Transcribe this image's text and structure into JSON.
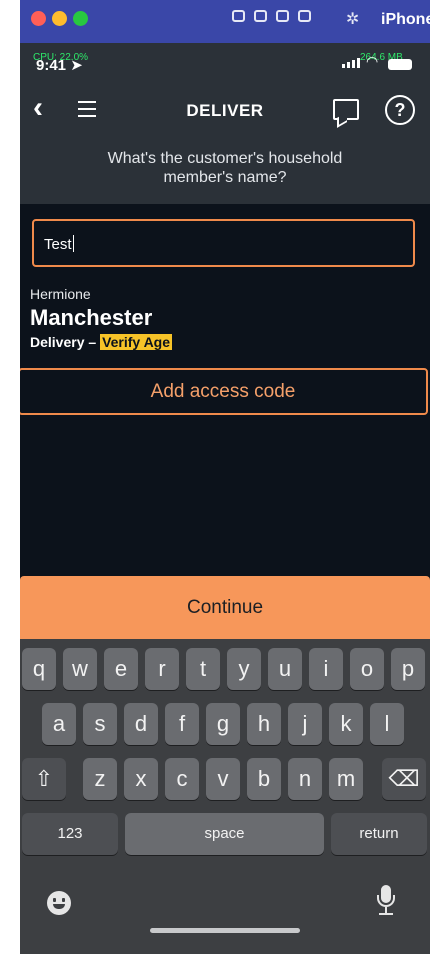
{
  "simulator": {
    "title": "iPhone",
    "controls": [
      "camera-icon",
      "record-icon",
      "home-icon",
      "rotate-icon",
      "settings-icon"
    ]
  },
  "status_bar": {
    "cpu": "CPU: 22.0%",
    "time": "9:41",
    "memory": "264.6 MB"
  },
  "header": {
    "back_icon": "chevron-left-icon",
    "menu_icon": "hamburger-icon",
    "title": "DELIVER",
    "chat_icon": "chat-bubble-icon",
    "help_label": "?"
  },
  "prompt": {
    "text": "What's the customer's household member's name?"
  },
  "name_input": {
    "value": "Test"
  },
  "address": {
    "name": "Hermione",
    "street": "Manchester",
    "delivery_type": "Delivery – ",
    "badge": "Verify Age",
    "badge_color": "#f7c328"
  },
  "buttons": {
    "add_access_code": "Add access code",
    "continue": "Continue"
  },
  "colors": {
    "accent": "#f7975a",
    "outline": "#f08a4b",
    "background": "#0c121b",
    "header": "#2b3138"
  },
  "keyboard": {
    "row1": [
      "q",
      "w",
      "e",
      "r",
      "t",
      "y",
      "u",
      "i",
      "o",
      "p"
    ],
    "row2": [
      "a",
      "s",
      "d",
      "f",
      "g",
      "h",
      "j",
      "k",
      "l"
    ],
    "row3": [
      "z",
      "x",
      "c",
      "v",
      "b",
      "n",
      "m"
    ],
    "shift_icon": "shift-icon",
    "delete_icon": "backspace-icon",
    "numbers_label": "123",
    "space_label": "space",
    "return_label": "return",
    "emoji_icon": "emoji-icon",
    "mic_icon": "microphone-icon"
  }
}
